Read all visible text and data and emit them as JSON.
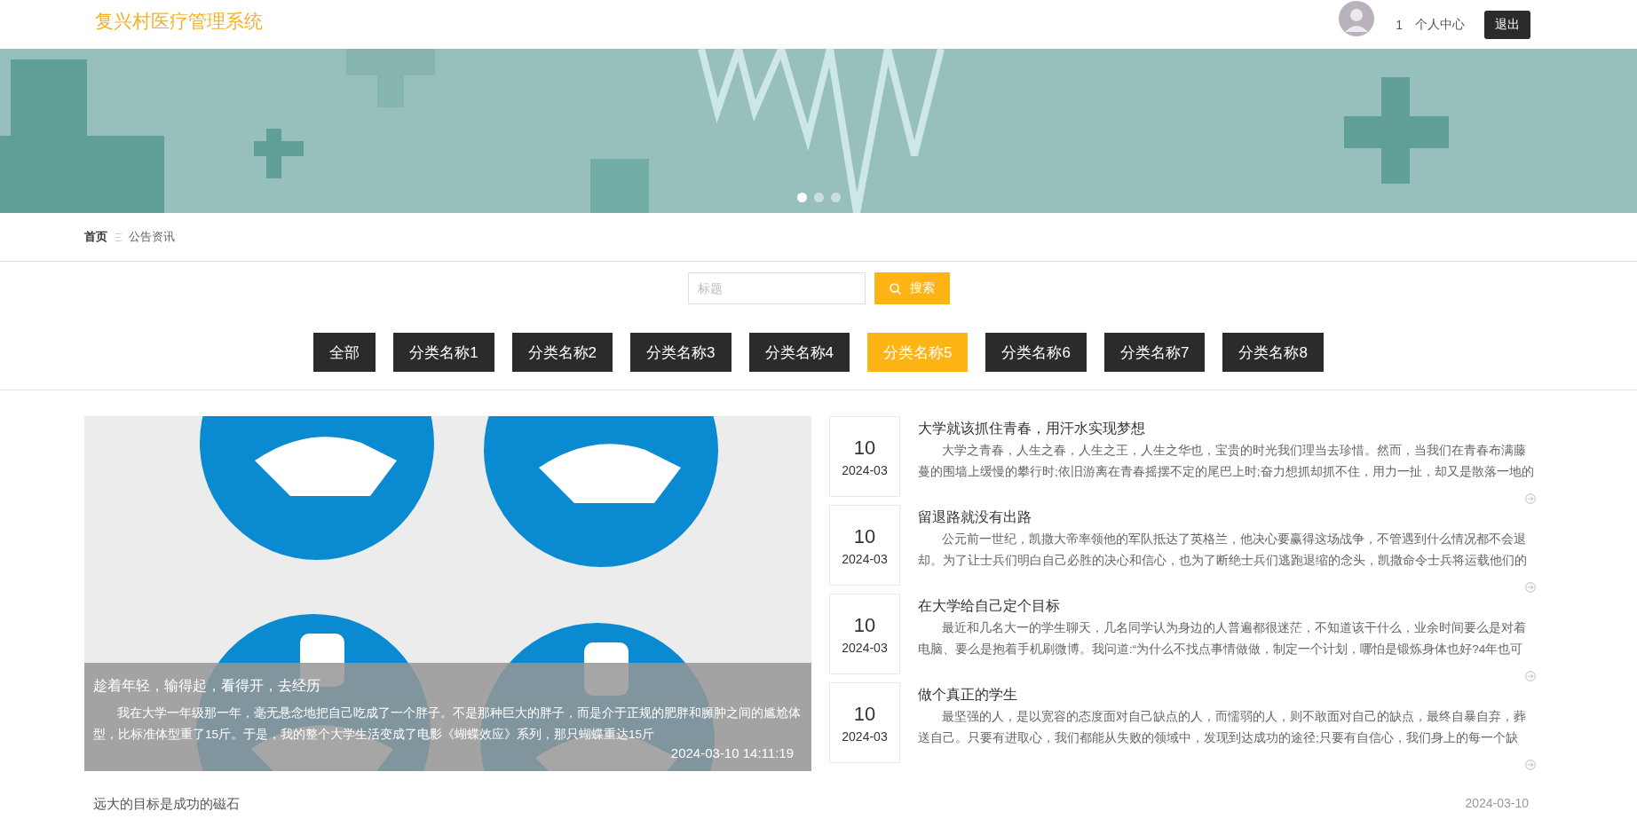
{
  "header": {
    "title": "复兴村医疗管理系统",
    "user": "1",
    "profile_link": "个人中心",
    "logout": "退出"
  },
  "carousel": {
    "dots": [
      {
        "selected": true
      },
      {
        "selected": false
      },
      {
        "selected": false
      }
    ]
  },
  "breadcrumb": [
    {
      "label": "首页",
      "selected": true
    },
    {
      "label": "公告资讯",
      "selected": false
    }
  ],
  "breadcrumb_separator": "Ξ",
  "search": {
    "placeholder": "标题",
    "button": "搜索"
  },
  "categories": [
    {
      "label": "全部",
      "selected": false
    },
    {
      "label": "分类名称1",
      "selected": false
    },
    {
      "label": "分类名称2",
      "selected": false
    },
    {
      "label": "分类名称3",
      "selected": false
    },
    {
      "label": "分类名称4",
      "selected": false
    },
    {
      "label": "分类名称5",
      "selected": true
    },
    {
      "label": "分类名称6",
      "selected": false
    },
    {
      "label": "分类名称7",
      "selected": false
    },
    {
      "label": "分类名称8",
      "selected": false
    }
  ],
  "featured": {
    "kind": "picture",
    "title": "趁着年轻，输得起，看得开，去经历",
    "summary": "我在大学一年级那一年，毫无悬念地把自己吃成了一个胖子。不是那种巨大的胖子，而是介于正规的肥胖和臃肿之间的尴尬体型，比标准体型重了15斤。于是，我的整个大学生活变成了电影《蝴蝶效应》系列，那只蝴蝶重达15斤",
    "time": "2024-03-10 14:11:19"
  },
  "news": [
    {
      "day": "10",
      "month": "2024-03",
      "title": "大学就该抓住青春，用汗水实现梦想",
      "summary": "大学之青春，人生之春，人生之王，人生之华也，宝贵的时光我们理当去珍惜。然而，当我们在青春布满藤蔓的围墙上缓慢的攀行时;依旧游离在青春摇摆不定的尾巴上时;奋力想抓却抓不住，用力一扯，却又是散落一地的"
    },
    {
      "day": "10",
      "month": "2024-03",
      "title": "留退路就没有出路",
      "summary": "公元前一世纪，凯撒大帝率领他的军队抵达了英格兰，他决心要赢得这场战争，不管遇到什么情况都不会退却。为了让士兵们明白自己必胜的决心和信心，也为了断绝士兵们逃跑退缩的念头，凯撒命令士兵将运载他们的"
    },
    {
      "day": "10",
      "month": "2024-03",
      "title": "在大学给自己定个目标",
      "summary": "最近和几名大一的学生聊天，几名同学认为身边的人普遍都很迷茫，不知道该干什么，业余时间要么是对着电脑、要么是抱着手机刷微博。我问道:“为什么不找点事情做做，制定一个计划，哪怕是锻炼身体也好?4年也可"
    },
    {
      "day": "10",
      "month": "2024-03",
      "title": "做个真正的学生",
      "summary": "最坚强的人，是以宽容的态度面对自己缺点的人，而懦弱的人，则不敢面对自己的缺点，最终自暴自弃，葬送自己。只要有进取心，我们都能从失败的领域中，发现到达成功的途径;只要有自信心，我们身上的每一个缺"
    }
  ],
  "bottom_item": {
    "title": "远大的目标是成功的磁石",
    "date": "2024-03-10"
  }
}
